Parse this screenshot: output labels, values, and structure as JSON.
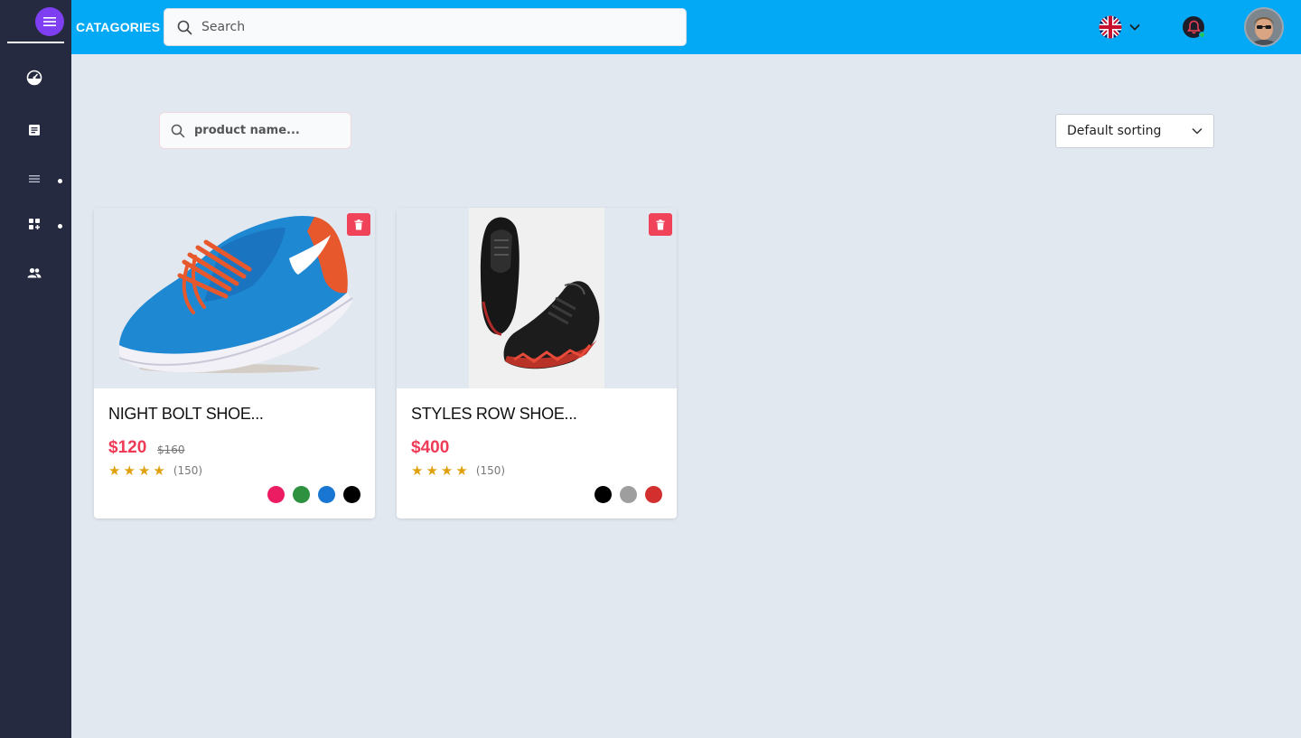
{
  "header": {
    "categories_label": "CATAGORIES",
    "search_placeholder": "Search"
  },
  "sidebar": {
    "items": [
      {
        "icon": "dashboard-icon"
      },
      {
        "icon": "document-icon"
      },
      {
        "icon": "list-icon",
        "has_submenu": true
      },
      {
        "icon": "apps-icon",
        "has_submenu": true
      },
      {
        "icon": "users-icon"
      }
    ]
  },
  "toolbar": {
    "product_search_placeholder": "product name...",
    "sort_value": "Default sorting"
  },
  "products": [
    {
      "name": "NIGHT BOLT SHOE...",
      "price": "$120",
      "old_price": "$160",
      "rating": 4,
      "reviews": "(150)",
      "colors": [
        "#ec1c63",
        "#2e9140",
        "#1976d2",
        "#000000"
      ]
    },
    {
      "name": "STYLES ROW SHOE...",
      "price": "$400",
      "rating": 4,
      "reviews": "(150)",
      "colors": [
        "#000000",
        "#9e9e9e",
        "#d32f2f"
      ]
    }
  ],
  "colors": {
    "header_bg": "#03a9f4",
    "sidebar_bg": "#252a40",
    "accent_purple": "#7e3ff2",
    "price_red": "#ef3b57",
    "star_gold": "#e0a10e"
  }
}
